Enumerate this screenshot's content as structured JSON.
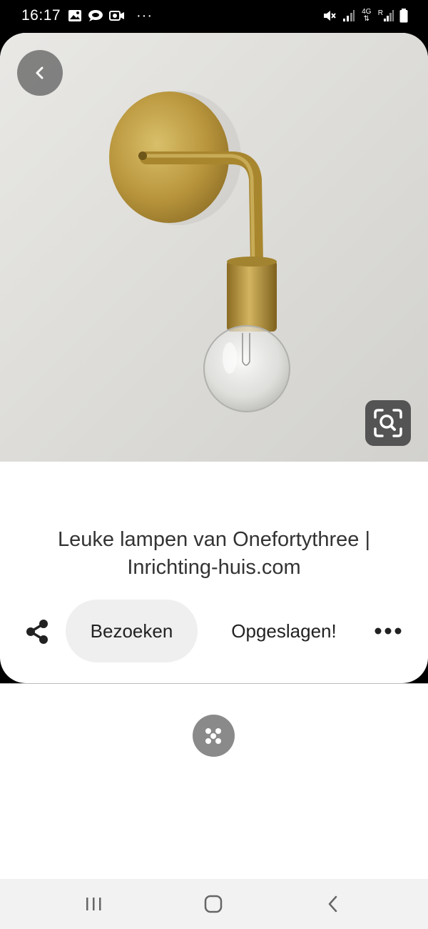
{
  "status_bar": {
    "time": "16:17",
    "left_icons": [
      "gallery-icon",
      "chat-icon",
      "screen-record-icon",
      "more-notifications-icon"
    ],
    "more_notifications": "···",
    "right_icons": [
      "mute-icon",
      "signal-icon",
      "network-4g-icon",
      "roaming-signal-icon",
      "battery-icon"
    ],
    "network_label": "4G",
    "roaming_label": "R"
  },
  "pin": {
    "title": "Leuke lampen van Onefortythree | Inrichting-huis.com",
    "image_subject": "brass-wall-lamp-photo"
  },
  "actions": {
    "visit_label": "Bezoeken",
    "saved_label": "Opgeslagen!",
    "share_icon": "share-icon",
    "more_icon": "more-dots-icon"
  },
  "overlay_buttons": {
    "back_icon": "chevron-left-icon",
    "lens_icon": "visual-search-icon"
  },
  "nav_bar": {
    "buttons": [
      "recent-apps-icon",
      "home-icon",
      "back-icon"
    ]
  },
  "colors": {
    "status_bar_bg": "#000000",
    "visit_button_bg": "#efefef",
    "lens_button_bg": "#545454",
    "nav_bar_bg": "#f2f2f2"
  }
}
